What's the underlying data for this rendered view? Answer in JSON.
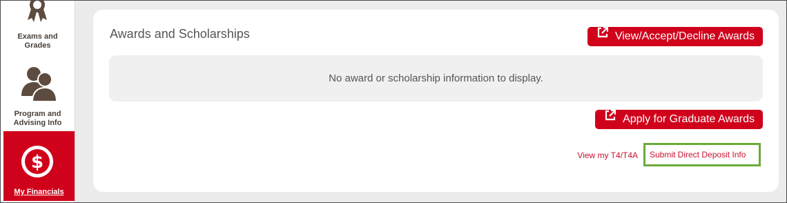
{
  "sidebar": {
    "items": [
      {
        "label_line1": "Exams and",
        "label_line2": "Grades",
        "icon": "award-ribbon-icon"
      },
      {
        "label_line1": "Program and",
        "label_line2": "Advising Info",
        "icon": "users-icon"
      },
      {
        "label": "My Financials",
        "icon": "dollar-circle-icon",
        "active": true
      }
    ]
  },
  "main": {
    "title": "Awards and Scholarships",
    "view_awards_button": "View/Accept/Decline Awards",
    "empty_message": "No award or scholarship information to display.",
    "apply_button": "Apply for Graduate Awards",
    "link_t4": "View my T4/T4A",
    "link_deposit": "Submit Direct Deposit Info"
  },
  "colors": {
    "accent_red": "#d0021b",
    "highlight_green": "#6aab3a",
    "sidebar_text": "#4b3f38"
  }
}
